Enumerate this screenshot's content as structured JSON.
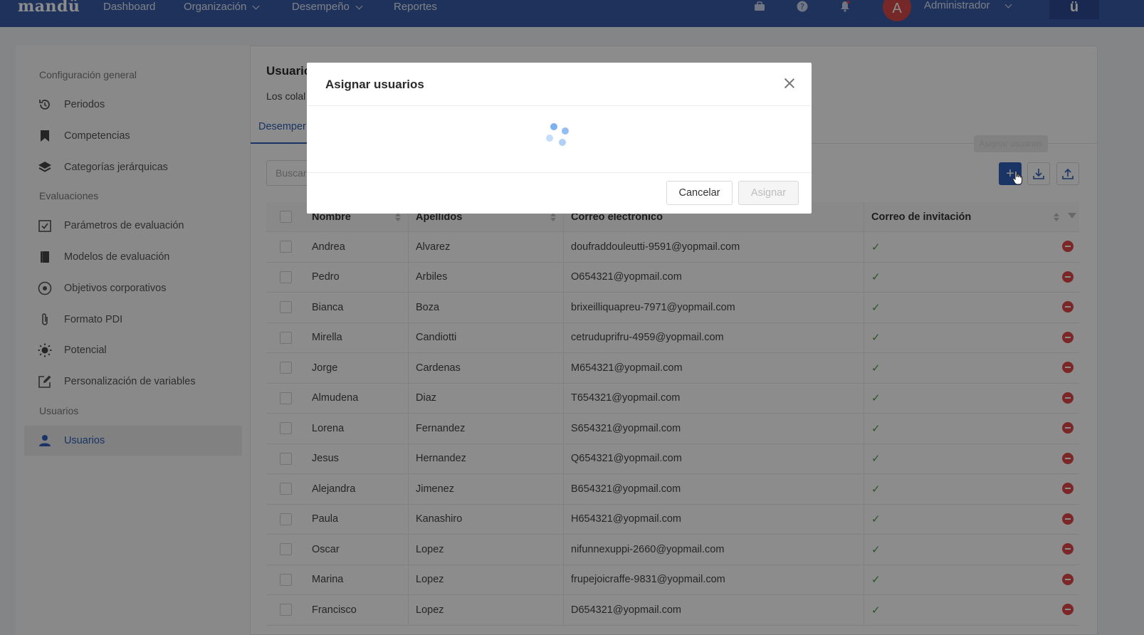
{
  "app": {
    "logo": "mandü",
    "brand_box": "ü",
    "nav": [
      {
        "label": "Dashboard"
      },
      {
        "label": "Organización"
      },
      {
        "label": "Desempeño"
      },
      {
        "label": "Reportes"
      }
    ],
    "user": {
      "initial": "A",
      "name": "Administrador"
    }
  },
  "sidebar": {
    "section_general": "Configuración general",
    "items_general": [
      {
        "label": "Periodos",
        "icon": "history-icon"
      },
      {
        "label": "Competencias",
        "icon": "bookmark-icon"
      },
      {
        "label": "Categorías jerárquicas",
        "icon": "layers-icon"
      }
    ],
    "section_eval": "Evaluaciones",
    "items_eval": [
      {
        "label": "Parámetros de evaluación",
        "icon": "checkbox-icon"
      },
      {
        "label": "Modelos de evaluación",
        "icon": "book-icon"
      },
      {
        "label": "Objetivos corporativos",
        "icon": "target-icon"
      },
      {
        "label": "Formato PDI",
        "icon": "paperclip-icon"
      },
      {
        "label": "Potencial",
        "icon": "sun-icon"
      },
      {
        "label": "Personalización de variables",
        "icon": "edit-icon"
      }
    ],
    "section_users": "Usuarios",
    "items_users": [
      {
        "label": "Usuarios",
        "icon": "user-icon",
        "active": true
      }
    ]
  },
  "main": {
    "title": "Usuaric",
    "description": "Los colal",
    "tab_active": "Desemper",
    "search_placeholder": "Buscar",
    "tooltip": "Asignar usuarios"
  },
  "table": {
    "headers": {
      "nombre": "Nombre",
      "apellidos": "Apellidos",
      "correo": "Correo electrónico",
      "invitacion": "Correo de invitación"
    },
    "rows": [
      {
        "nombre": "Andrea",
        "apellidos": "Alvarez",
        "correo": "doufraddouleutti-9591@yopmail.com",
        "invitacion": "✓"
      },
      {
        "nombre": "Pedro",
        "apellidos": "Arbiles",
        "correo": "O654321@yopmail.com",
        "invitacion": "✓"
      },
      {
        "nombre": "Bianca",
        "apellidos": "Boza",
        "correo": "brixeilliquapreu-7971@yopmail.com",
        "invitacion": "✓"
      },
      {
        "nombre": "Mirella",
        "apellidos": "Candiotti",
        "correo": "cetruduprifru-4959@yopmail.com",
        "invitacion": "✓"
      },
      {
        "nombre": "Jorge",
        "apellidos": "Cardenas",
        "correo": "M654321@yopmail.com",
        "invitacion": "✓"
      },
      {
        "nombre": "Almudena",
        "apellidos": "Diaz",
        "correo": "T654321@yopmail.com",
        "invitacion": "✓"
      },
      {
        "nombre": "Lorena",
        "apellidos": "Fernandez",
        "correo": "S654321@yopmail.com",
        "invitacion": "✓"
      },
      {
        "nombre": "Jesus",
        "apellidos": "Hernandez",
        "correo": "Q654321@yopmail.com",
        "invitacion": "✓"
      },
      {
        "nombre": "Alejandra",
        "apellidos": "Jimenez",
        "correo": "B654321@yopmail.com",
        "invitacion": "✓"
      },
      {
        "nombre": "Paula",
        "apellidos": "Kanashiro",
        "correo": "H654321@yopmail.com",
        "invitacion": "✓"
      },
      {
        "nombre": "Oscar",
        "apellidos": "Lopez",
        "correo": "nifunnexuppi-2660@yopmail.com",
        "invitacion": "✓"
      },
      {
        "nombre": "Marina",
        "apellidos": "Lopez",
        "correo": "frupejoicraffe-9831@yopmail.com",
        "invitacion": "✓"
      },
      {
        "nombre": "Francisco",
        "apellidos": "Lopez",
        "correo": "D654321@yopmail.com",
        "invitacion": "✓"
      }
    ]
  },
  "modal": {
    "title": "Asignar usuarios",
    "cancel": "Cancelar",
    "assign": "Asignar"
  },
  "colors": {
    "nav_bg": "#3a5ba8",
    "accent": "#2f5fb8",
    "remove": "#e04848",
    "spinner": "#6fa8f0"
  }
}
